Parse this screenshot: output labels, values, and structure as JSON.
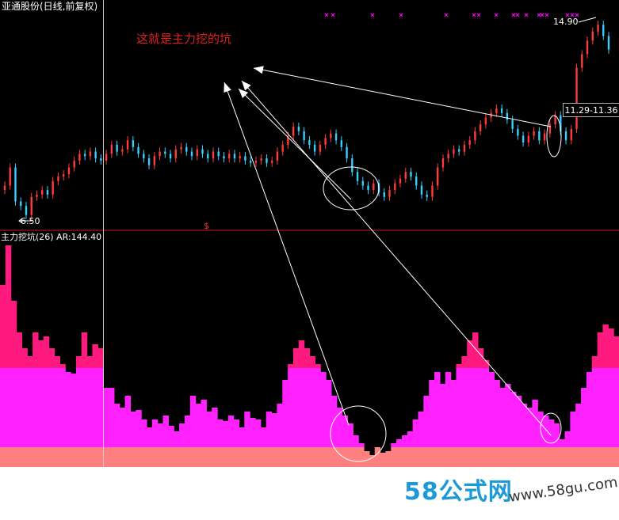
{
  "window": {
    "title": "亚通股份(日线,前复权)"
  },
  "annotation": {
    "text": "这就是主力挖的坑"
  },
  "indicator": {
    "label": "主力挖坑(26)  AR:144.40",
    "levels": {
      "upper": 125,
      "lower": 25
    }
  },
  "price_labels": {
    "high": "14.90",
    "low": "6.50",
    "range": "11.29-11.36",
    "marker": "$"
  },
  "watermark": {
    "brand": "58公式网",
    "url": "www.58gu.com"
  },
  "colors": {
    "background": "#000000",
    "up_candle": "#ff3b3b",
    "down_candle": "#36d0ff",
    "indicator_high": "#ff1a80",
    "indicator_mid": "#ff22ff",
    "indicator_low": "#ff8080",
    "divider": "#c81e1e",
    "x_marker": "#ff00ff"
  },
  "chart_data": [
    {
      "type": "candlestick",
      "title": "亚通股份(日线,前复权)",
      "high_label": 14.9,
      "low_label": 6.5,
      "ylim": [
        6.0,
        15.5
      ],
      "series": [
        {
          "values": [
            7.8,
            8.6,
            7.1,
            6.9,
            6.5,
            7.3,
            7.4,
            7.6,
            7.4,
            8.0,
            8.2,
            8.3,
            8.6,
            8.9,
            9.2,
            9.1,
            9.3,
            9.0,
            8.9,
            9.2,
            9.6,
            9.3,
            9.4,
            9.8,
            9.5,
            9.2,
            9.0,
            8.7,
            9.1,
            9.3,
            9.2,
            9.0,
            9.4,
            9.5,
            9.3,
            9.1,
            9.4,
            9.2,
            9.0,
            9.3,
            9.1,
            9.0,
            9.2,
            9.0,
            9.1,
            8.9,
            8.8,
            8.9,
            9.0,
            8.8,
            8.9,
            9.3,
            9.6,
            10.0,
            10.4,
            10.2,
            9.8,
            9.6,
            9.3,
            9.6,
            9.9,
            10.1,
            9.8,
            9.5,
            9.0,
            8.4,
            8.0,
            7.8,
            7.6,
            7.9,
            7.5,
            7.3,
            7.6,
            7.9,
            8.1,
            8.4,
            8.2,
            7.8,
            7.4,
            7.3,
            7.8,
            8.6,
            9.0,
            9.2,
            9.4,
            9.3,
            9.6,
            9.8,
            10.2,
            10.5,
            10.8,
            11.0,
            11.2,
            11.0,
            10.7,
            10.3,
            10.0,
            9.7,
            10.0,
            10.2,
            9.8,
            10.1,
            10.5,
            10.9,
            10.2,
            9.8,
            10.3,
            13.0,
            13.6,
            14.2,
            14.6,
            14.9,
            14.4,
            13.8
          ]
        }
      ]
    },
    {
      "type": "bar",
      "title": "主力挖坑(26)",
      "value_label": "AR:144.40",
      "threshold_upper": 125,
      "threshold_lower": 25,
      "ylim": [
        0,
        280
      ],
      "series": [
        {
          "name": "AR",
          "values": [
            230,
            280,
            210,
            170,
            150,
            140,
            170,
            160,
            165,
            150,
            140,
            130,
            120,
            118,
            140,
            170,
            140,
            155,
            150,
            100,
            100,
            80,
            75,
            90,
            70,
            72,
            60,
            50,
            60,
            55,
            65,
            52,
            45,
            55,
            65,
            90,
            80,
            85,
            70,
            75,
            60,
            58,
            65,
            60,
            50,
            70,
            62,
            60,
            50,
            70,
            68,
            80,
            110,
            130,
            150,
            160,
            150,
            140,
            130,
            120,
            110,
            90,
            75,
            65,
            55,
            40,
            30,
            20,
            15,
            25,
            18,
            20,
            30,
            35,
            40,
            45,
            60,
            70,
            90,
            110,
            120,
            105,
            120,
            110,
            130,
            140,
            160,
            170,
            150,
            135,
            120,
            110,
            100,
            105,
            95,
            90,
            80,
            75,
            85,
            70,
            65,
            60,
            55,
            35,
            45,
            70,
            80,
            100,
            120,
            140,
            170,
            180,
            175,
            165
          ]
        }
      ]
    }
  ]
}
